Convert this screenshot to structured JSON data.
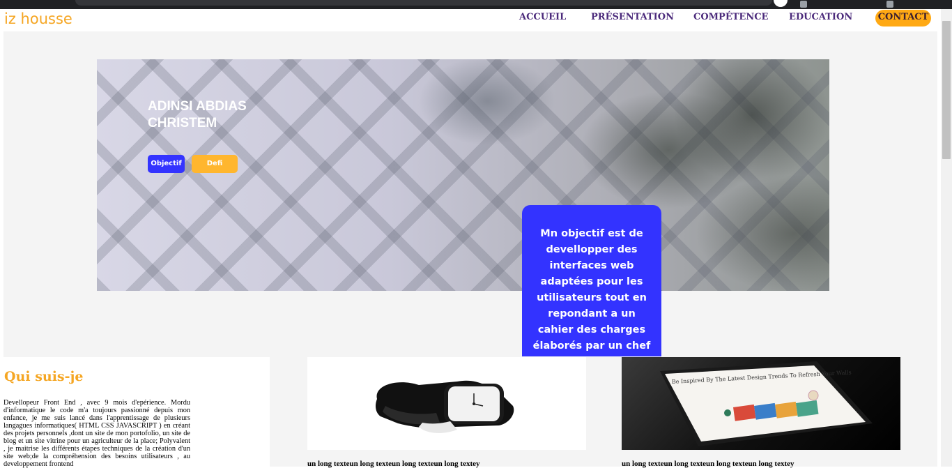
{
  "brand": {
    "logo": "iz housse"
  },
  "nav": {
    "items": [
      "ACCUEIL",
      "PRÉSENTATION",
      "COMPÉTENCE",
      "EDUCATION"
    ],
    "contact": "CONTACT"
  },
  "hero": {
    "title": "ADINSI ABDIAS CHRISTEM",
    "btn_objectif": "Objectif",
    "btn_defi": "Defi",
    "objective_text": "Mn objectif est de devellopper des interfaces web adaptées pour les utilisateurs tout en repondant a un cahier des charges élaborés par un chef de projet"
  },
  "about": {
    "title": "Qui suis-je",
    "text": "Devellopeur Front End , avec 9 mois d'epérience. Mordu d'informatique le code m'a toujours passionné depuis mon enfance, je me suis lancé dans l'apprentissage de plusieurs langagues informatiques( HTML CSS JAVASCRIPT ) en créant des projets personnels ,dont un site de mon portofolio, un site de blog et un site vitrine pour un agriculteur de la place; Polyvalent , je maitrise les différents étapes techniques de la création d'un site web;de la compréhension des besoins utilisateurs , au developpement frontend"
  },
  "cards": [
    {
      "caption": "un long texteun long texteun long texteun long textey"
    },
    {
      "caption": "un long texteun long texteun long texteun long textey"
    }
  ],
  "tablet_screen": {
    "headline": "Be Inspired By The Latest Design Trends To Refresh Your Walls"
  },
  "colors": {
    "accent_orange": "#ffa914",
    "accent_blue": "#3333ff",
    "nav_text": "#4b2a7b"
  }
}
